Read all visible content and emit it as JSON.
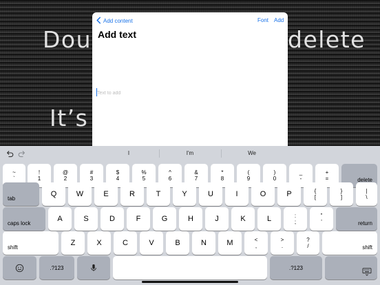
{
  "board": {
    "line1_left": "Doub",
    "line1_right": "delete",
    "line2": "It’s"
  },
  "modal": {
    "back_label": "Add content",
    "font_label": "Font",
    "add_label": "Add",
    "title": "Add text",
    "input_placeholder": "Text to add",
    "input_value": ""
  },
  "keyboard": {
    "suggestions": [
      "I",
      "I'm",
      "We"
    ],
    "row1": [
      {
        "top": "~",
        "bottom": "`"
      },
      {
        "top": "!",
        "bottom": "1"
      },
      {
        "top": "@",
        "bottom": "2"
      },
      {
        "top": "#",
        "bottom": "3"
      },
      {
        "top": "$",
        "bottom": "4"
      },
      {
        "top": "%",
        "bottom": "5"
      },
      {
        "top": "^",
        "bottom": "6"
      },
      {
        "top": "&",
        "bottom": "7"
      },
      {
        "top": "*",
        "bottom": "8"
      },
      {
        "top": "(",
        "bottom": "9"
      },
      {
        "top": ")",
        "bottom": "0"
      },
      {
        "top": "_",
        "bottom": "-"
      },
      {
        "top": "+",
        "bottom": "="
      }
    ],
    "delete_label": "delete",
    "tab_label": "tab",
    "row2": [
      "Q",
      "W",
      "E",
      "R",
      "T",
      "Y",
      "U",
      "I",
      "O",
      "P"
    ],
    "row2_dual": [
      {
        "top": "{",
        "bottom": "["
      },
      {
        "top": "}",
        "bottom": "]"
      },
      {
        "top": "|",
        "bottom": "\\"
      }
    ],
    "caps_label": "caps lock",
    "row3": [
      "A",
      "S",
      "D",
      "F",
      "G",
      "H",
      "J",
      "K",
      "L"
    ],
    "row3_dual": [
      {
        "top": ":",
        "bottom": ";"
      },
      {
        "top": "”",
        "bottom": "’"
      }
    ],
    "return_label": "return",
    "shift_label": "shift",
    "row4": [
      "Z",
      "X",
      "C",
      "V",
      "B",
      "N",
      "M"
    ],
    "row4_dual": [
      {
        "top": "<",
        "bottom": ","
      },
      {
        "top": ">",
        "bottom": "."
      },
      {
        "top": "?",
        "bottom": "/"
      }
    ],
    "numbers_label": ".?123",
    "icons": {
      "undo": "undo-icon",
      "redo": "redo-icon",
      "emoji": "emoji-icon",
      "mic": "microphone-icon",
      "hide": "keyboard-dismiss-icon",
      "back": "chevron-left-icon"
    },
    "accent_color": "#1a73e8"
  }
}
